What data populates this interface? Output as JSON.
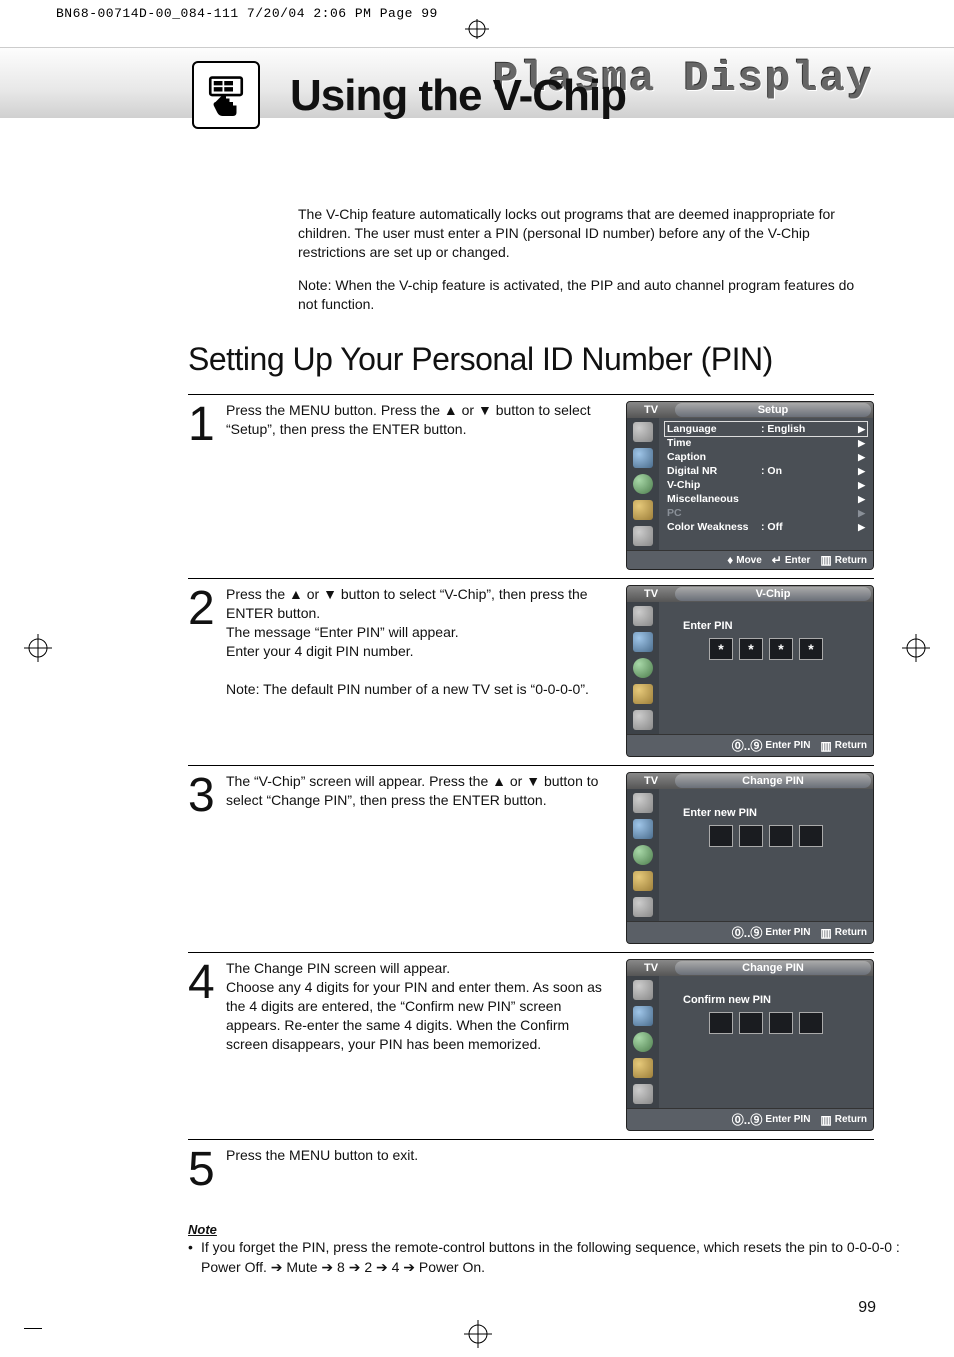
{
  "print_line": "BN68-00714D-00_084-111  7/20/04  2:06 PM  Page 99",
  "banner_title": "Plasma Display",
  "chapter_title": "Using the V-Chip",
  "intro_paragraph": "The V-Chip feature automatically locks out programs that are deemed inappropriate for children. The user must enter a PIN (personal ID number) before any of the V-Chip restrictions are set up or changed.",
  "intro_note": "Note: When the V-chip feature is activated, the PIP and auto channel program features do not function.",
  "section_heading": "Setting Up Your Personal ID Number (PIN)",
  "steps": [
    {
      "num": "1",
      "text": "Press the MENU button. Press the ▲ or ▼ button to select “Setup”, then press the ENTER button."
    },
    {
      "num": "2",
      "text": "Press the ▲ or ▼ button to select “V-Chip”, then press the ENTER button.\nThe message “Enter PIN” will appear.\nEnter your 4 digit PIN number.",
      "note": "Note: The default PIN number of a new TV set is “0-0-0-0”."
    },
    {
      "num": "3",
      "text": "The “V-Chip” screen will appear. Press the ▲ or ▼ button to select “Change PIN”, then press the ENTER button."
    },
    {
      "num": "4",
      "text": "The Change PIN screen will appear.\nChoose any 4 digits for your PIN and enter them. As soon as the 4 digits are entered, the “Confirm new PIN” screen appears. Re-enter the same 4 digits. When the Confirm screen disappears, your PIN has been memorized."
    },
    {
      "num": "5",
      "text": "Press the MENU button to exit."
    }
  ],
  "osd_common": {
    "tv_label": "TV"
  },
  "osd1": {
    "title": "Setup",
    "rows": [
      {
        "k": "Language",
        "v": ":  English",
        "sel": true
      },
      {
        "k": "Time",
        "v": ""
      },
      {
        "k": "Caption",
        "v": ""
      },
      {
        "k": "Digital NR",
        "v": ":  On"
      },
      {
        "k": "V-Chip",
        "v": ""
      },
      {
        "k": "Miscellaneous",
        "v": ""
      },
      {
        "k": "PC",
        "v": "",
        "dim": true
      },
      {
        "k": "Color Weakness",
        "v": ":  Off"
      }
    ],
    "footer": {
      "move": "Move",
      "enter": "Enter",
      "ret": "Return"
    }
  },
  "osd2": {
    "title": "V-Chip",
    "prompt": "Enter PIN",
    "pin_values": [
      "*",
      "*",
      "*",
      "*"
    ],
    "footer": {
      "enter": "Enter PIN",
      "ret": "Return"
    }
  },
  "osd3": {
    "title": "Change PIN",
    "prompt": "Enter new PIN",
    "pin_values": [
      "",
      "",
      "",
      ""
    ],
    "footer": {
      "enter": "Enter PIN",
      "ret": "Return"
    }
  },
  "osd4": {
    "title": "Change PIN",
    "prompt": "Confirm new PIN",
    "pin_values": [
      "",
      "",
      "",
      ""
    ],
    "footer": {
      "enter": "Enter PIN",
      "ret": "Return"
    }
  },
  "note": {
    "title": "Note",
    "text": "If you forget the PIN, press the remote-control buttons in the following sequence, which resets the pin to  0-0-0-0 : Power Off. ➔ Mute ➔ 8 ➔ 2 ➔ 4 ➔ Power On."
  },
  "page_number": "99"
}
